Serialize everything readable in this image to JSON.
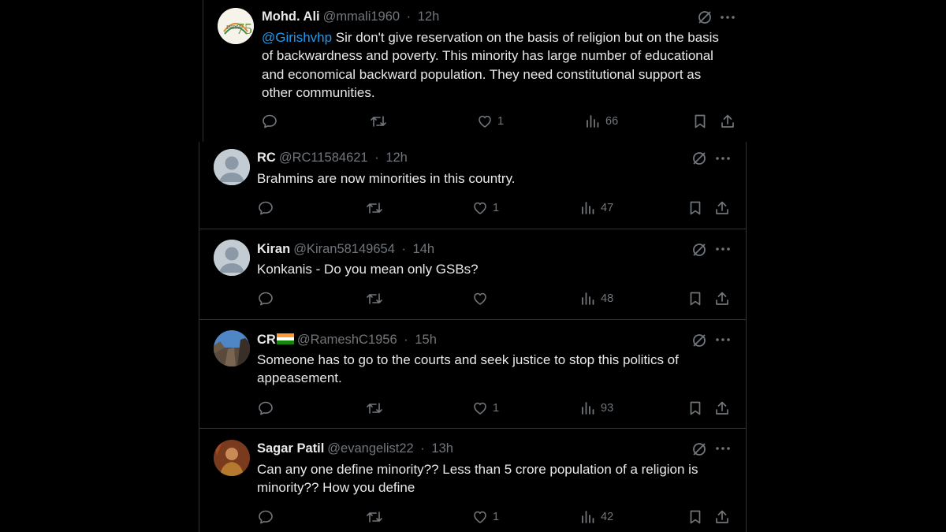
{
  "tweets": [
    {
      "name": "Mohd. Ali",
      "handle": "@mmali1960",
      "time": "12h",
      "mention": "@Girishvhp",
      "text": " Sir don't give reservation on the basis of religion but on the basis of backwardness and poverty. This minority has large number of educational and economical backward population. They need constitutional support as other communities.",
      "likes": "1",
      "views": "66",
      "avatar": "india75-logo"
    },
    {
      "name": "RC",
      "handle": "@RC11584621",
      "time": "12h",
      "text": "Brahmins are now minorities in this country.",
      "likes": "1",
      "views": "47",
      "avatar": "default-avatar"
    },
    {
      "name": "Kiran",
      "handle": "@Kiran58149654",
      "time": "14h",
      "text": "Konkanis - Do you mean only GSBs?",
      "likes": "",
      "views": "48",
      "avatar": "default-avatar"
    },
    {
      "name": "CR",
      "handle": "@RameshC1956",
      "time": "15h",
      "text": "Someone has to go to the courts and seek justice to stop this politics of appeasement.",
      "likes": "1",
      "views": "93",
      "avatar": "landscape-photo"
    },
    {
      "name": "Sagar Patil",
      "handle": "@evangelist22",
      "time": "13h",
      "text": "Can any one define minority?? Less than 5 crore population of a religion is minority?? How you define",
      "likes": "1",
      "views": "42",
      "avatar": "warrior-photo"
    }
  ],
  "separator": "·",
  "colors": {
    "background": "#000000",
    "text": "#e7e9ea",
    "muted": "#71767b",
    "link": "#1d9bf0",
    "border": "#2f3336"
  },
  "icons": [
    "grok-icon",
    "more-icon",
    "reply-icon",
    "retweet-icon",
    "like-icon",
    "views-icon",
    "bookmark-icon",
    "share-icon"
  ]
}
